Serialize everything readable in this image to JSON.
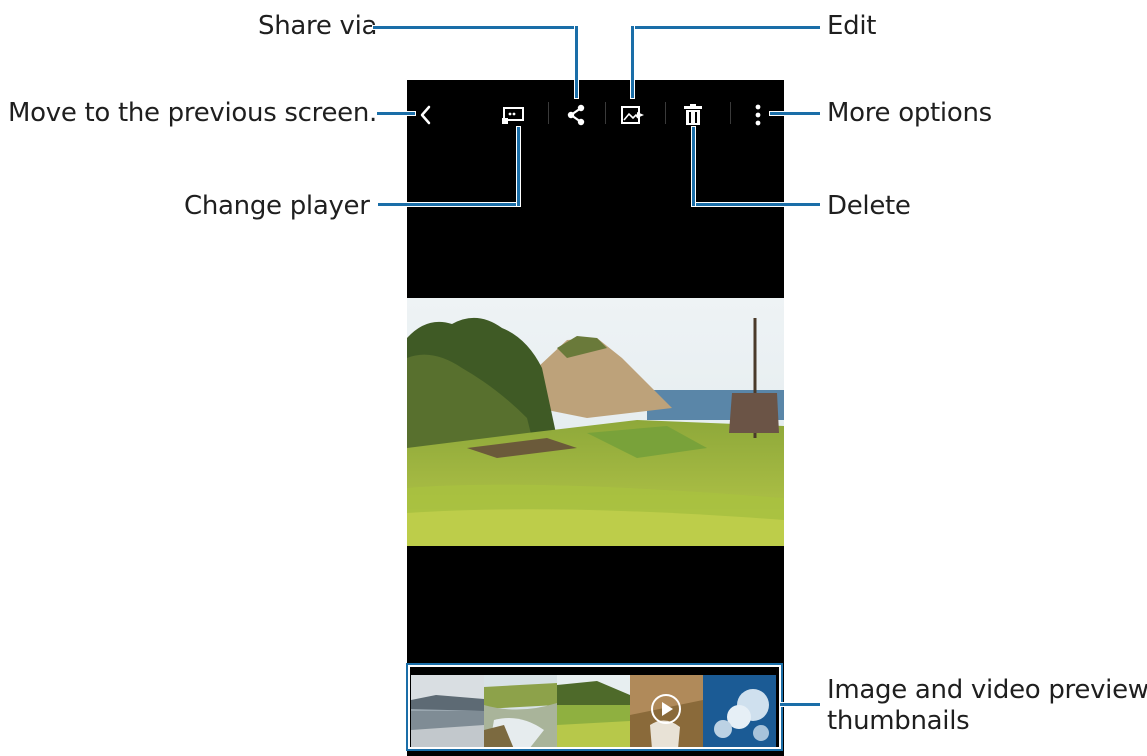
{
  "callouts": {
    "share_via": "Share via",
    "edit": "Edit",
    "back": "Move to the previous screen.",
    "more_options": "More options",
    "change_player": "Change player",
    "delete": "Delete",
    "thumbnails_line1": "Image and video preview",
    "thumbnails_line2": "thumbnails"
  },
  "action_bar": {
    "icons": [
      "back-icon",
      "change-player-icon",
      "share-icon",
      "edit-icon",
      "delete-icon",
      "more-options-icon"
    ]
  },
  "colors": {
    "callout_line": "#1a6ea8",
    "screen_background": "#000000",
    "label_text": "#1f1f1f"
  }
}
